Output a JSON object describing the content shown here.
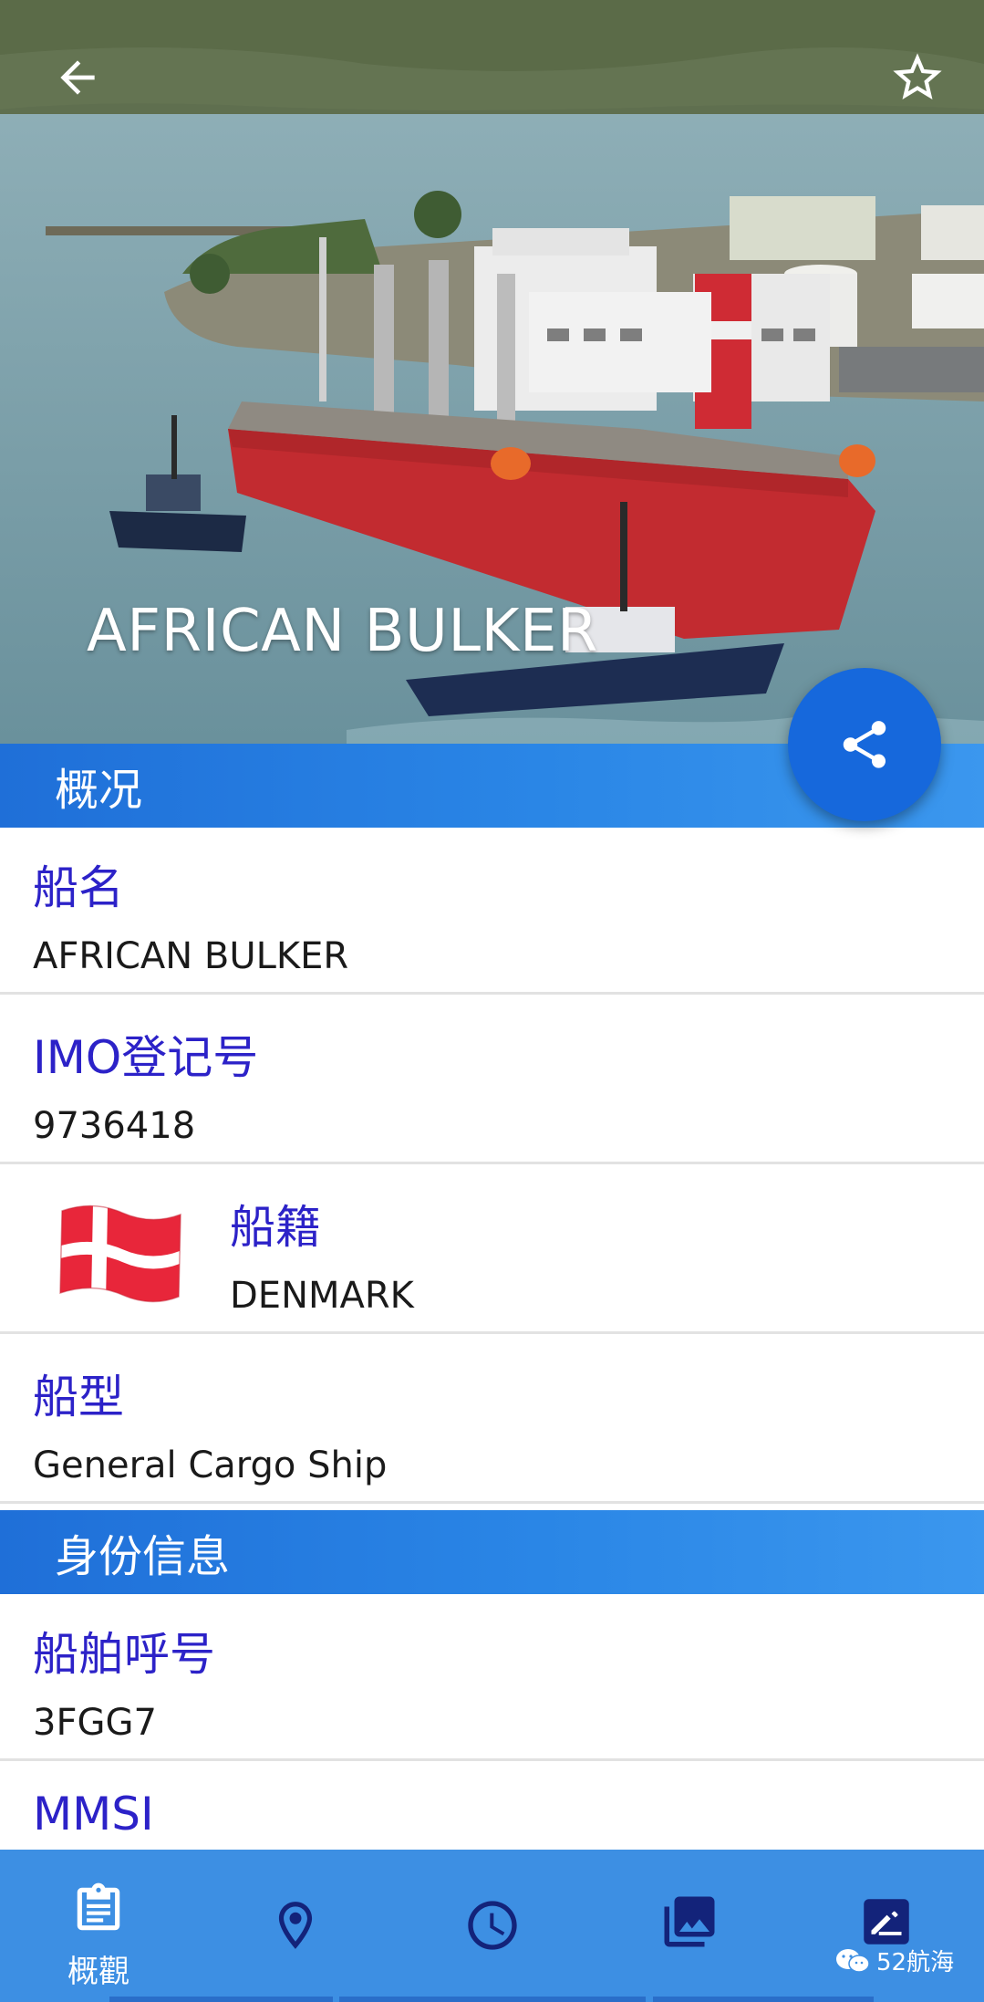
{
  "hero": {
    "title": "AFRICAN BULKER"
  },
  "sections": {
    "overview": "概况",
    "identity": "身份信息"
  },
  "overview_rows": {
    "ship_name": {
      "label": "船名",
      "value": "AFRICAN BULKER"
    },
    "imo": {
      "label": "IMO登记号",
      "value": "9736418"
    },
    "flag": {
      "label": "船籍",
      "value": "DENMARK"
    },
    "ship_type": {
      "label": "船型",
      "value": "General Cargo Ship"
    }
  },
  "identity_rows": {
    "call_sign": {
      "label": "船舶呼号",
      "value": "3FGG7"
    },
    "mmsi": {
      "label": "MMSI",
      "value": ""
    }
  },
  "bottom_nav": {
    "items": [
      {
        "label": "概觀",
        "icon": "clipboard-icon",
        "active": true
      },
      {
        "label": "",
        "icon": "location-pin-icon",
        "active": false
      },
      {
        "label": "",
        "icon": "clock-icon",
        "active": false
      },
      {
        "label": "",
        "icon": "photo-library-icon",
        "active": false
      },
      {
        "label": "",
        "icon": "edit-note-icon",
        "active": false
      }
    ]
  },
  "watermark": {
    "text": "52航海"
  },
  "colors": {
    "accent": "#1668dc",
    "section_header": "#2a86e6",
    "label_text": "#2c22c8",
    "bottom_nav": "#3d8fe3",
    "nav_icon": "#13237a"
  }
}
